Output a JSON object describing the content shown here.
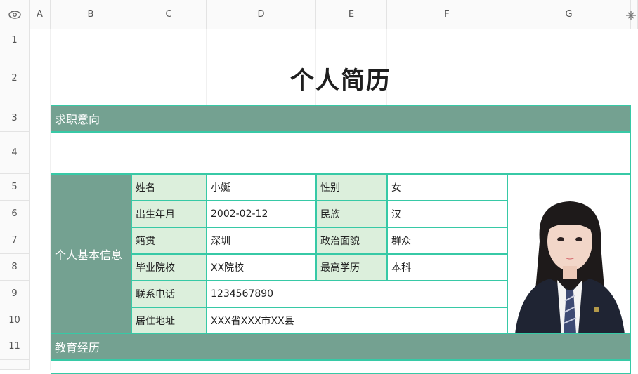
{
  "columns": [
    "A",
    "B",
    "C",
    "D",
    "E",
    "F",
    "G"
  ],
  "rows": [
    "1",
    "2",
    "3",
    "4",
    "5",
    "6",
    "7",
    "8",
    "9",
    "10",
    "11"
  ],
  "doc": {
    "title": "个人简历",
    "sections": {
      "job_intent": "求职意向",
      "basic_info": "个人基本信息",
      "education": "教育经历"
    },
    "fields": [
      {
        "label": "姓名",
        "value": "小娫",
        "label2": "性别",
        "value2": "女"
      },
      {
        "label": "出生年月",
        "value": "2002-02-12",
        "label2": "民族",
        "value2": "汉"
      },
      {
        "label": "籍贯",
        "value": "深圳",
        "label2": "政治面貌",
        "value2": "群众"
      },
      {
        "label": "毕业院校",
        "value": "XX院校",
        "label2": "最高学历",
        "value2": "本科"
      }
    ],
    "phone": {
      "label": "联系电话",
      "value": "1234567890"
    },
    "address": {
      "label": "居住地址",
      "value": "XXX省XXX市XX县"
    }
  },
  "colors": {
    "band": "#74a191",
    "label_bg": "#dcefdc",
    "border": "#37c9a6"
  }
}
